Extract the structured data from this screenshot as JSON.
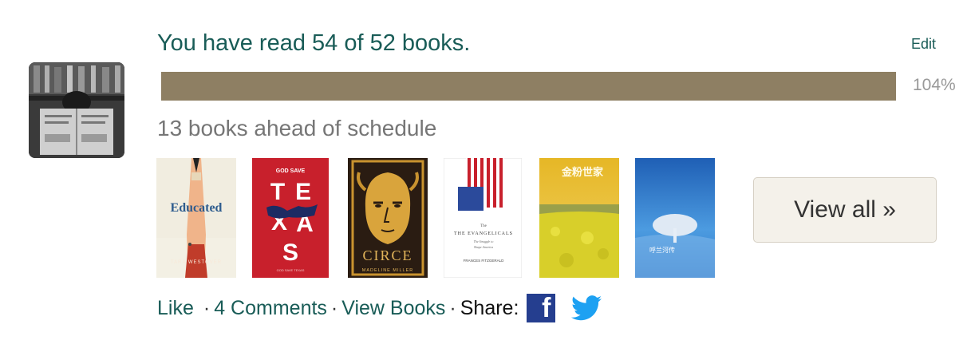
{
  "challenge": {
    "title": "You have read 54 of 52 books.",
    "edit_label": "Edit",
    "progress_fraction": 1.0,
    "percent_label": "104%",
    "schedule_text": "13 books ahead of schedule"
  },
  "books": [
    {
      "title": "Educated",
      "author": "TARA WESTOVER",
      "cover_color": "#f1ede0"
    },
    {
      "title": "GOD SAVE TEXAS",
      "author": "",
      "cover_color": "#c8202c"
    },
    {
      "title": "CIRCE",
      "author": "MADELINE MILLER",
      "cover_color": "#2a1c12"
    },
    {
      "title": "THE EVANGELICALS",
      "author": "FRANCES FITZGERALD",
      "cover_color": "#ffffff"
    },
    {
      "title": "金粉世家",
      "author": "",
      "cover_color": "#d9b326"
    },
    {
      "title": "呼兰河传",
      "author": "",
      "cover_color": "#2f7ecb"
    }
  ],
  "view_all_label": "View all »",
  "footer": {
    "like_label": "Like",
    "comments_label": "4 Comments",
    "view_books_label": "View Books",
    "share_label": "Share:",
    "facebook_glyph": "f"
  },
  "icons": [
    "facebook-icon",
    "twitter-icon"
  ],
  "colors": {
    "link": "#195c57",
    "progress": "#8e7f63",
    "button_bg": "#f4f1ea"
  }
}
